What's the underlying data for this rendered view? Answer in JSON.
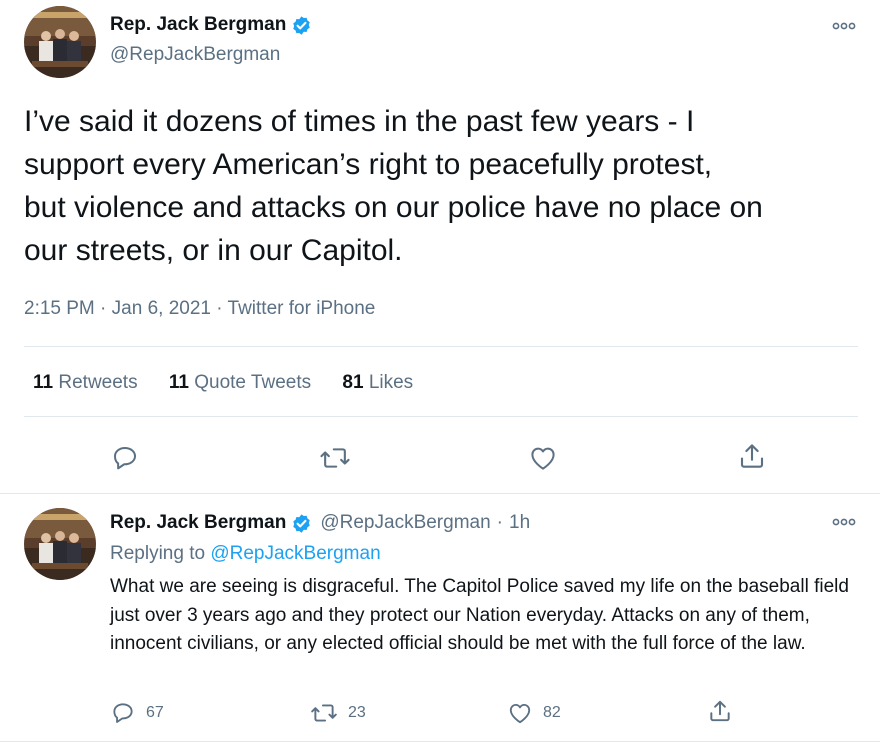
{
  "main_tweet": {
    "author": {
      "name": "Rep. Jack Bergman",
      "handle": "@RepJackBergman"
    },
    "text": "I’ve said it dozens of times in the past few years - I\nsupport every American’s right to peacefully protest,\nbut violence and attacks on our police have no place on\nour streets, or in our Capitol.",
    "time": "2:15 PM",
    "date": "Jan 6, 2021",
    "source": "Twitter for iPhone",
    "sep": "·",
    "stats": [
      {
        "count": "11",
        "label": "Retweets"
      },
      {
        "count": "11",
        "label": "Quote Tweets"
      },
      {
        "count": "81",
        "label": "Likes"
      }
    ]
  },
  "reply_tweet": {
    "author": {
      "name": "Rep. Jack Bergman",
      "handle": "@RepJackBergman"
    },
    "sep": "·",
    "time_ago": "1h",
    "replying_label": "Replying to",
    "replying_handle": "@RepJackBergman",
    "text": "What we are seeing is disgraceful. The Capitol Police saved my life on the baseball field just over 3 years ago and they protect our Nation everyday. Attacks on any of them, innocent civilians, or any elected official should be met with the full force of the law.",
    "reply_count": "67",
    "retweet_count": "23",
    "like_count": "82"
  },
  "colors": {
    "text": "#0f1419",
    "secondary": "#5b7083",
    "accent": "#1da1f2",
    "divider": "#e1e8ed"
  },
  "icons": [
    "more-icon",
    "verified-icon",
    "reply-icon",
    "retweet-icon",
    "like-icon",
    "share-icon"
  ]
}
